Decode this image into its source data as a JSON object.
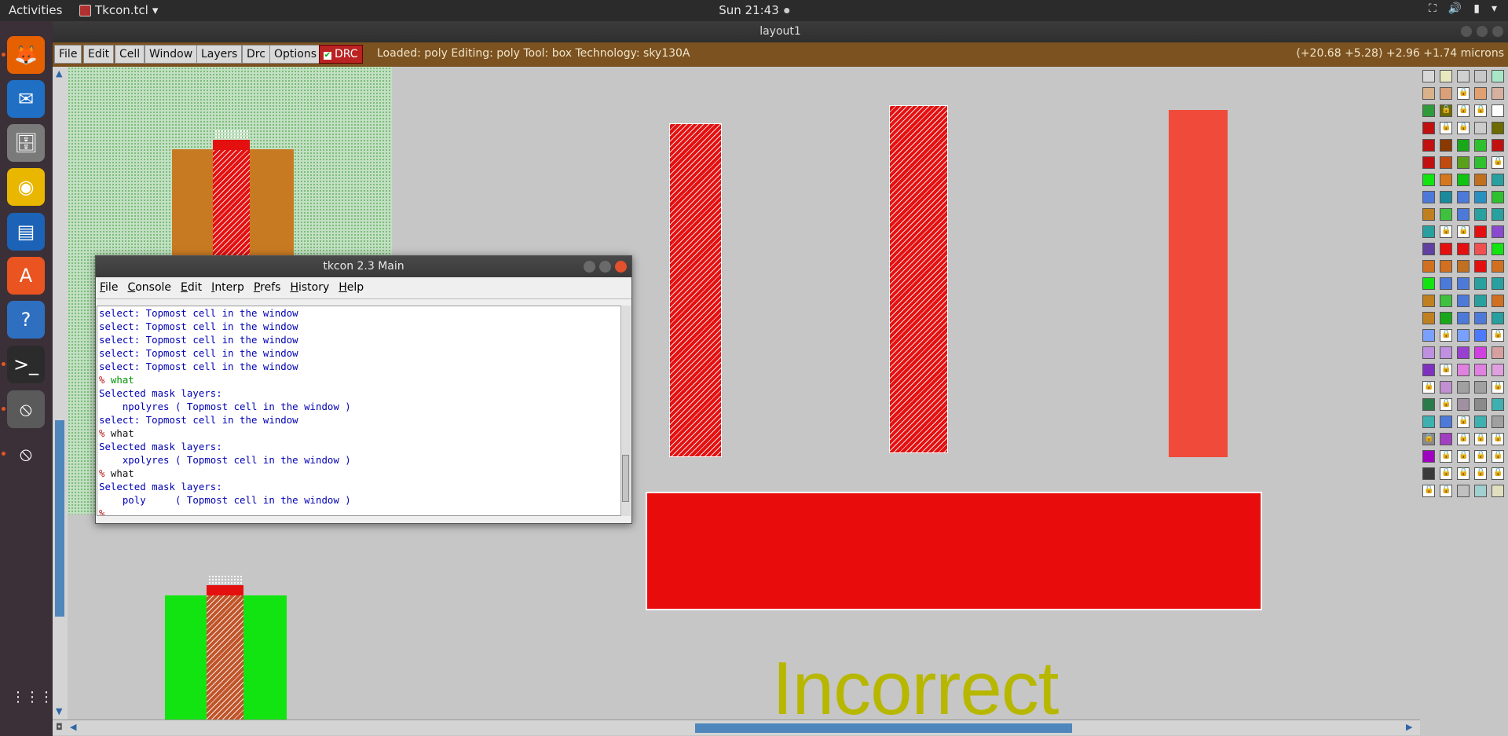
{
  "topbar": {
    "activities": "Activities",
    "app_name": "Tkcon.tcl",
    "clock": "Sun 21:43"
  },
  "window": {
    "title": "layout1"
  },
  "dock": {
    "items": [
      {
        "name": "firefox-icon",
        "glyph": "🦊",
        "bg": "#e66000",
        "running": true
      },
      {
        "name": "thunderbird-icon",
        "glyph": "✉",
        "bg": "#1f6fc5",
        "running": false
      },
      {
        "name": "files-icon",
        "glyph": "🗄",
        "bg": "#7a7a7a",
        "running": false
      },
      {
        "name": "rhythmbox-icon",
        "glyph": "◉",
        "bg": "#e9b600",
        "running": false
      },
      {
        "name": "writer-icon",
        "glyph": "▤",
        "bg": "#1c63b7",
        "running": false
      },
      {
        "name": "software-icon",
        "glyph": "A",
        "bg": "#e95420",
        "running": false
      },
      {
        "name": "help-icon",
        "glyph": "?",
        "bg": "#2e6fc0",
        "running": false
      },
      {
        "name": "terminal-icon",
        "glyph": ">_",
        "bg": "#2b2b2b",
        "running": true
      },
      {
        "name": "xwindow-app-icon",
        "glyph": "⦸",
        "bg": "#5a5a5a",
        "running": true
      },
      {
        "name": "xwindow-app-icon-2",
        "glyph": "⦸",
        "bg": "#3b3037",
        "running": true
      }
    ],
    "apps_grid_glyph": "⋮⋮⋮"
  },
  "menubar": {
    "buttons": [
      "File",
      "Edit",
      "Cell",
      "Window",
      "Layers",
      "Drc",
      "Options"
    ],
    "drc_toggle": "DRC",
    "status": "Loaded: poly Editing: poly Tool: box  Technology: sky130A",
    "coords": "(+20.68 +5.28) +2.96 +1.74 microns"
  },
  "canvas": {
    "label_text": "Incorrect"
  },
  "tkcon": {
    "title": "tkcon 2.3 Main",
    "menu": [
      "File",
      "Console",
      "Edit",
      "Interp",
      "Prefs",
      "History",
      "Help"
    ],
    "lines": [
      {
        "type": "out",
        "text": "select: Topmost cell in the window"
      },
      {
        "type": "out",
        "text": "select: Topmost cell in the window"
      },
      {
        "type": "out",
        "text": "select: Topmost cell in the window"
      },
      {
        "type": "out",
        "text": "select: Topmost cell in the window"
      },
      {
        "type": "out",
        "text": "select: Topmost cell in the window"
      },
      {
        "type": "prompt",
        "prompt": "% ",
        "cmd": "what",
        "cmdclass": "cmd"
      },
      {
        "type": "out",
        "text": "Selected mask layers:"
      },
      {
        "type": "out",
        "text": "    npolyres ( Topmost cell in the window )"
      },
      {
        "type": "out",
        "text": "select: Topmost cell in the window"
      },
      {
        "type": "prompt",
        "prompt": "% ",
        "cmd": "what",
        "cmdclass": "cmdplain"
      },
      {
        "type": "out",
        "text": "Selected mask layers:"
      },
      {
        "type": "out",
        "text": "    xpolyres ( Topmost cell in the window )"
      },
      {
        "type": "prompt",
        "prompt": "% ",
        "cmd": "what",
        "cmdclass": "cmdplain"
      },
      {
        "type": "out",
        "text": "Selected mask layers:"
      },
      {
        "type": "out",
        "text": "    poly     ( Topmost cell in the window )"
      },
      {
        "type": "prompt",
        "prompt": "%",
        "cmd": "",
        "cmdclass": "cmdplain"
      }
    ]
  },
  "palette": {
    "colors": [
      "#d8d8d8",
      "#e8e8c0",
      "#d0d0d0",
      "#c8c8c8",
      "#a8e6c8",
      "#d9b28c",
      "#d9a07a",
      "#ffffff",
      "#e1a070",
      "#d7b0a0",
      "#2f9b3c",
      "#6b6b00",
      "#ffffff",
      "#ffffff",
      "#ffffff",
      "#c01010",
      "#ffffff",
      "#ffffff",
      "#cccccc",
      "#6b6b00",
      "#c01010",
      "#8a3a00",
      "#1aa81a",
      "#2fc02f",
      "#c01010",
      "#c01010",
      "#c04a10",
      "#5aa01a",
      "#2fc02f",
      "#ffffff",
      "#12e412",
      "#d47820",
      "#12c412",
      "#c07020",
      "#29a0a0",
      "#4d79d9",
      "#1a8a9a",
      "#4d79d9",
      "#2a90c0",
      "#2fc02f",
      "#c08020",
      "#3fc03f",
      "#4d79d9",
      "#29a0a0",
      "#29a0a0",
      "#29a0a0",
      "#ffffff",
      "#ffffff",
      "#e41010",
      "#8a4ad0",
      "#6040a0",
      "#e41010",
      "#e41010",
      "#f05050",
      "#12e412",
      "#d07020",
      "#d07020",
      "#c07020",
      "#e41010",
      "#d07020",
      "#12e412",
      "#4d79d9",
      "#4d79d9",
      "#29a0a0",
      "#29a0a0",
      "#c08020",
      "#3fc03f",
      "#4d79d9",
      "#29a0a0",
      "#d07020",
      "#c08020",
      "#1aa81a",
      "#4d79d9",
      "#4d79d9",
      "#29a0a0",
      "#7aa0ff",
      "#ffffff",
      "#7aa0ff",
      "#4d79ff",
      "#ffffff",
      "#c090e0",
      "#c090e0",
      "#9a40d0",
      "#d040e0",
      "#d7a0a0",
      "#8030c0",
      "#ffffff",
      "#e080e0",
      "#e080e0",
      "#e0a0e0",
      "#ffffff",
      "#c090d0",
      "#a0a0a0",
      "#a0a0a0",
      "#ffffff",
      "#2a7a4a",
      "#ffffff",
      "#a090a0",
      "#8a8a8a",
      "#3fb0b0",
      "#3fb0b0",
      "#4d79d9",
      "#ffffff",
      "#3fb0b0",
      "#a0a0a0",
      "#8a8a8a",
      "#a040c0",
      "#ffffff",
      "#ffffff",
      "#ffffff",
      "#a000c0",
      "#ffffff",
      "#ffffff",
      "#ffffff",
      "#ffffff",
      "#3a3a3a",
      "#ffffff",
      "#ffffff",
      "#ffffff",
      "#ffffff",
      "#ffffff",
      "#ffffff",
      "#c0c0c0",
      "#a0d0d0",
      "#e0e0c0"
    ],
    "locked": [
      7,
      11,
      12,
      13,
      16,
      17,
      29,
      46,
      47,
      76,
      79,
      86,
      90,
      94,
      96,
      102,
      105,
      107,
      108,
      109,
      111,
      112,
      113,
      114,
      116,
      117,
      118,
      119,
      120,
      121
    ]
  }
}
